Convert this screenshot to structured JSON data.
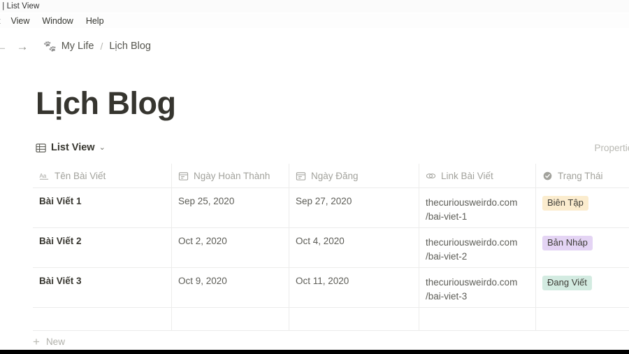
{
  "window": {
    "title": "og | List View",
    "menu_items": [
      "t",
      "View",
      "Window",
      "Help"
    ]
  },
  "nav": {
    "back_icon": "arrow-left-icon",
    "back_glyph": "←",
    "forward_icon": "arrow-right-icon",
    "forward_glyph": "→",
    "breadcrumb": {
      "emoji": "🐾",
      "parent": "My Life",
      "separator": "/",
      "current": "Lịch Blog"
    }
  },
  "page": {
    "title": "Lịch Blog"
  },
  "viewbar": {
    "icon": "table-grid-icon",
    "label": "List View",
    "chevron": "⌄",
    "properties_label": "Properties"
  },
  "table": {
    "columns": [
      {
        "label": "Tên Bài Viết",
        "icon": "text-aa-icon"
      },
      {
        "label": "Ngày Hoàn Thành",
        "icon": "calendar-icon"
      },
      {
        "label": "Ngày Đăng",
        "icon": "calendar-icon"
      },
      {
        "label": "Link Bài Viết",
        "icon": "link-icon"
      },
      {
        "label": "Trạng Thái",
        "icon": "select-circle-icon"
      }
    ],
    "rows": [
      {
        "title": "Bài Viết 1",
        "ngay_hoan_thanh": "Sep 25, 2020",
        "ngay_dang": "Sep 27, 2020",
        "link_line1": "thecuriousweirdo.com",
        "link_line2": "/bai-viet-1",
        "status": "Biên Tập",
        "status_bg": "#fbecce"
      },
      {
        "title": "Bài Viết 2",
        "ngay_hoan_thanh": "Oct 2, 2020",
        "ngay_dang": "Oct 4, 2020",
        "link_line1": "thecuriousweirdo.com",
        "link_line2": "/bai-viet-2",
        "status": "Bản Nháp",
        "status_bg": "#e4d4f4"
      },
      {
        "title": "Bài Viết 3",
        "ngay_hoan_thanh": "Oct 9, 2020",
        "ngay_dang": "Oct 11, 2020",
        "link_line1": "thecuriousweirdo.com",
        "link_line2": "/bai-viet-3",
        "status": "Đang Viết",
        "status_bg": "#d3ebe1"
      }
    ]
  },
  "footer": {
    "new_plus": "+",
    "new_label": "New"
  },
  "colors": {
    "text_primary": "#37362f",
    "text_secondary": "#5d5d57",
    "text_muted": "#a2a29c",
    "border": "#ececeb",
    "background": "#ffffff"
  }
}
